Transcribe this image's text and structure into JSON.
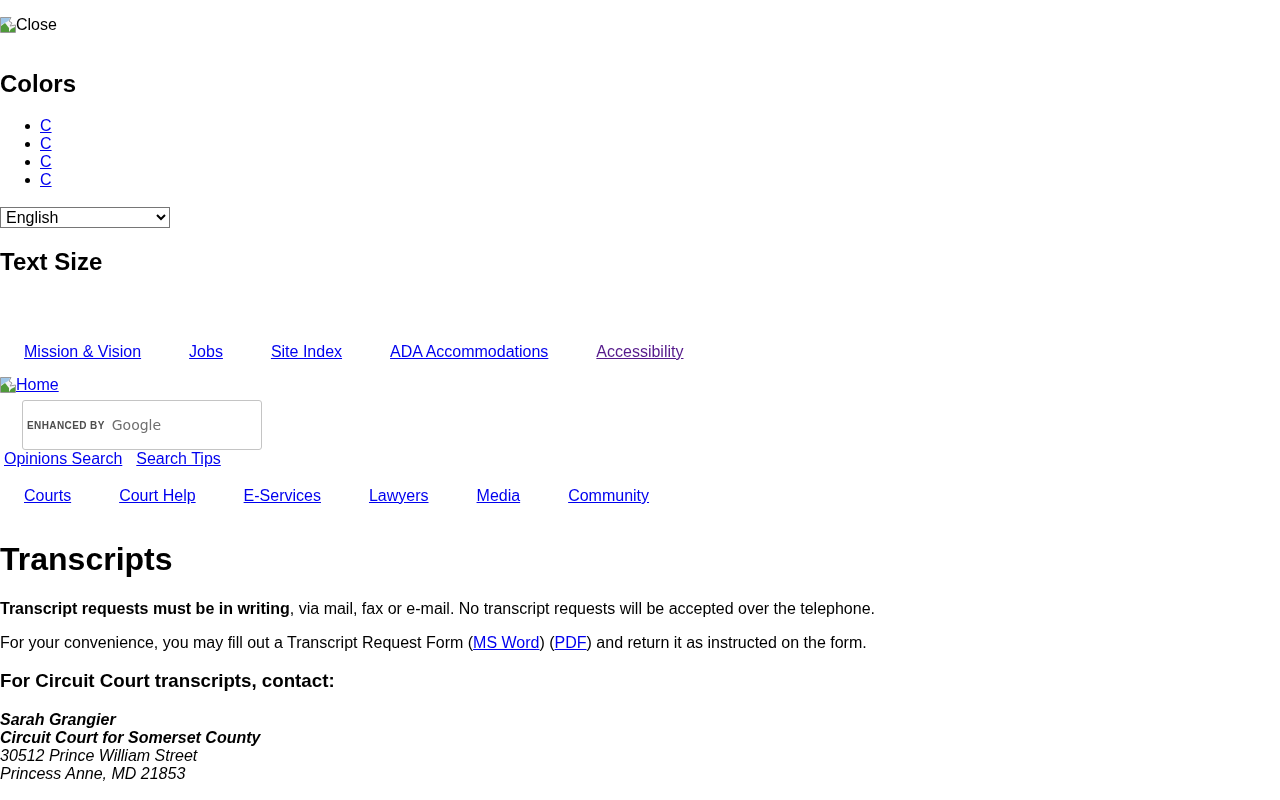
{
  "close_button": {
    "label": "Close"
  },
  "colors_panel": {
    "heading": "Colors",
    "options": [
      {
        "label": "C"
      },
      {
        "label": "C"
      },
      {
        "label": "C"
      },
      {
        "label": "C"
      }
    ]
  },
  "language_select": {
    "value": "English"
  },
  "text_size_panel": {
    "heading": "Text Size"
  },
  "utility_nav": [
    {
      "label": "Mission & Vision",
      "visited": false
    },
    {
      "label": "Jobs",
      "visited": false
    },
    {
      "label": "Site Index",
      "visited": false
    },
    {
      "label": "ADA Accommodations",
      "visited": false
    },
    {
      "label": "Accessibility",
      "visited": true
    }
  ],
  "home_link": {
    "label": "Home"
  },
  "search": {
    "watermark": "ENHANCED BY",
    "wordmark": "Google"
  },
  "search_links": [
    {
      "label": "Opinions Search"
    },
    {
      "label": "Search Tips"
    }
  ],
  "main_nav": [
    {
      "label": "Courts"
    },
    {
      "label": "Court Help"
    },
    {
      "label": "E-Services"
    },
    {
      "label": "Lawyers"
    },
    {
      "label": "Media"
    },
    {
      "label": "Community"
    }
  ],
  "content": {
    "title": "Transcripts",
    "notice": "**Transcript requests must be in writing**, via mail, fax or e-mail. No transcript requests will be accepted over the telephone.",
    "form_paragraph": [
      {
        "kind": "text",
        "text": "For your convenience, you may fill out a Transcript Request Form ("
      },
      {
        "kind": "link",
        "text": "MS Word"
      },
      {
        "kind": "text",
        "text": ") ("
      },
      {
        "kind": "link",
        "text": "PDF"
      },
      {
        "kind": "text",
        "text": ") and return it as instructed on the form."
      }
    ],
    "contact_heading": "For Circuit Court transcripts, contact:",
    "address_lines": [
      {
        "text": "Sarah Grangier",
        "bold": true
      },
      {
        "text": "Circuit Court for Somerset County",
        "bold": true
      },
      {
        "text": "30512 Prince William Street",
        "bold": false
      },
      {
        "text": "Princess Anne, MD 21853",
        "bold": false
      }
    ]
  }
}
